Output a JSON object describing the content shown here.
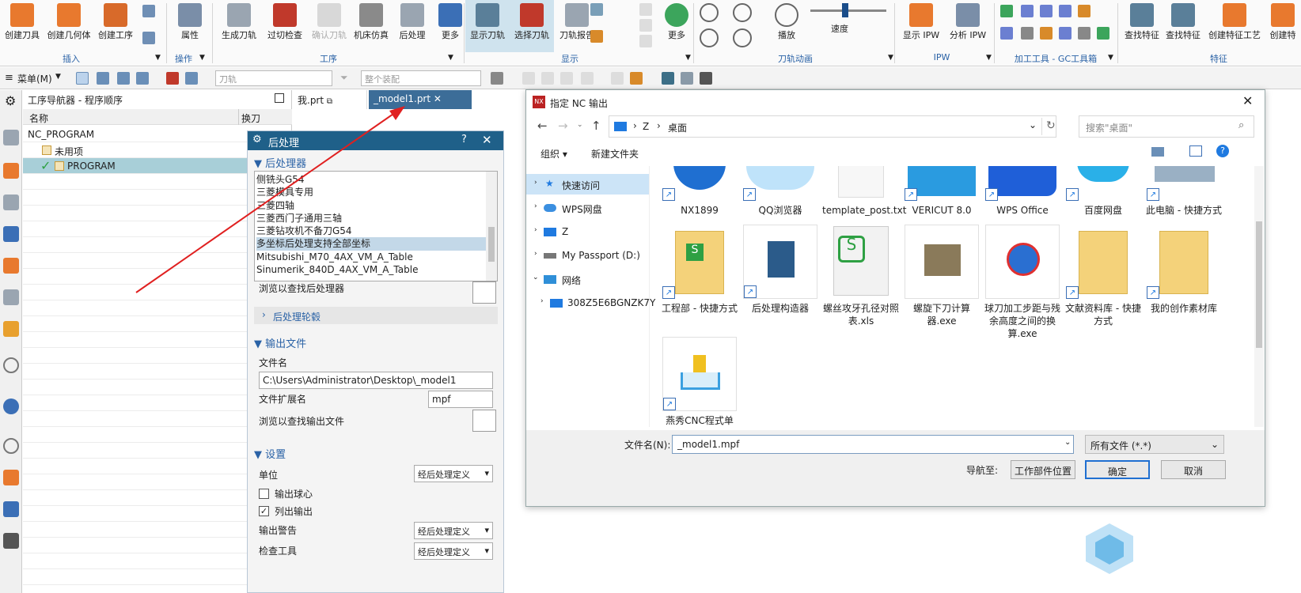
{
  "ribbon": {
    "buttons": [
      "创建刀具",
      "创建几何体",
      "创建工序",
      "属性",
      "生成刀轨",
      "过切检查",
      "确认刀轨",
      "机床仿真",
      "后处理",
      "更多",
      "显示刀轨",
      "选择刀轨",
      "刀轨报告",
      "更多",
      "播放",
      "显示 IPW",
      "分析 IPW",
      "查找特征",
      "查找特征",
      "创建特征工艺",
      "创建特"
    ],
    "groups": [
      "插入",
      "操作",
      "工序",
      "显示",
      "刀轨动画",
      "IPW",
      "加工工具 - GC工具箱",
      "特征"
    ],
    "speed_label": "速度"
  },
  "toolbar2": {
    "menu_label": "菜单(M)",
    "combo1": "刀轨",
    "combo2": "整个装配"
  },
  "navigator": {
    "title": "工序导航器 - 程序顺序",
    "col_name": "名称",
    "col_tool": "换刀",
    "rows": [
      "NC_PROGRAM",
      "未用项",
      "PROGRAM"
    ]
  },
  "tabs": [
    {
      "label": "我.prt"
    },
    {
      "label": "_model1.prt"
    }
  ],
  "postprocess": {
    "title": "后处理",
    "sec_post": "后处理器",
    "list": [
      "侧铣头G54",
      "三菱模具专用",
      "三菱四轴",
      "三菱西门子通用三轴",
      "三菱钻攻机不备刀G54",
      "多坐标后处理支持全部坐标",
      "Mitsubishi_M70_4AX_VM_A_Table",
      "Sinumerik_840D_4AX_VM_A_Table"
    ],
    "browse_post": "浏览以查找后处理器",
    "sub_section": "后处理轮毂",
    "sec_output": "输出文件",
    "filename_label": "文件名",
    "filename_value": "C:\\Users\\Administrator\\Desktop\\_model1",
    "ext_label": "文件扩展名",
    "ext_value": "mpf",
    "browse_output": "浏览以查找输出文件",
    "sec_settings": "设置",
    "unit_label": "单位",
    "unit_value": "经后处理定义",
    "chk1": "输出球心",
    "chk2": "列出输出",
    "warn_label": "输出警告",
    "warn_value": "经后处理定义",
    "check_label": "检查工具",
    "check_value": "经后处理定义"
  },
  "dialog": {
    "title": "指定 NC 输出",
    "path_parts": [
      "Z",
      "桌面"
    ],
    "search_placeholder": "搜索\"桌面\"",
    "organize": "组织",
    "new_folder": "新建文件夹",
    "tree": [
      "快速访问",
      "WPS网盘",
      "Z",
      "My Passport (D:)",
      "网络",
      "308Z5E6BGNZK7Y"
    ],
    "files_row1": [
      "NX1899",
      "QQ浏览器",
      "template_post.txt",
      "VERICUT 8.0",
      "WPS Office",
      "百度网盘",
      "此电脑 - 快捷方式"
    ],
    "files_row2": [
      "工程部 - 快捷方式",
      "后处理构造器",
      "螺丝攻牙孔径对照表.xls",
      "螺旋下刀计算器.exe",
      "球刀加工步距与残余高度之间的换算.exe",
      "文献资料库 - 快捷方式",
      "我的创作素材库"
    ],
    "files_row3": [
      "燕秀CNC程式单"
    ],
    "filename_label": "文件名(N):",
    "filename_value": "_model1.mpf",
    "filter": "所有文件 (*.*)",
    "nav_label": "导航至:",
    "nav_button": "工作部件位置",
    "ok": "确定",
    "cancel": "取消"
  }
}
